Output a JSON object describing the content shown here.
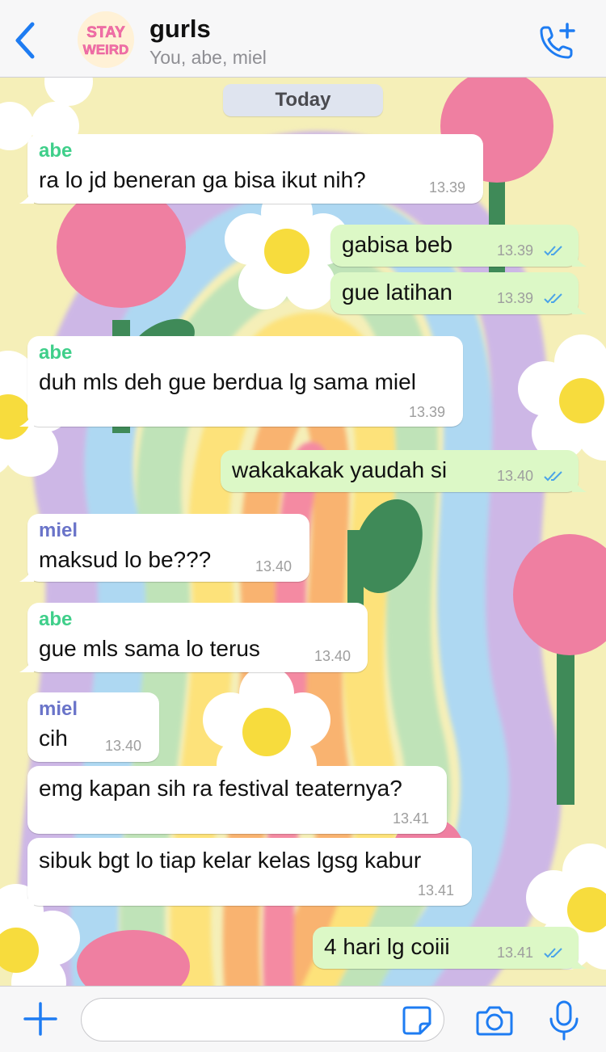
{
  "header": {
    "title": "gurls",
    "subtitle": "You, abe, miel",
    "avatar_text_line1": "STAY",
    "avatar_text_line2": "WEIRD"
  },
  "date_label": "Today",
  "messages": [
    {
      "dir": "in",
      "sender": "abe",
      "text": "ra lo jd beneran ga bisa ikut nih?",
      "time": "13.39"
    },
    {
      "dir": "out",
      "text": "gabisa beb",
      "time": "13.39",
      "status": "read"
    },
    {
      "dir": "out",
      "text": "gue latihan",
      "time": "13.39",
      "status": "read"
    },
    {
      "dir": "in",
      "sender": "abe",
      "text": "duh mls deh gue berdua lg sama miel",
      "time": "13.39"
    },
    {
      "dir": "out",
      "text": "wakakakak yaudah si",
      "time": "13.40",
      "status": "read"
    },
    {
      "dir": "in",
      "sender": "miel",
      "text": "maksud lo be???",
      "time": "13.40"
    },
    {
      "dir": "in",
      "sender": "abe",
      "text": "gue mls sama lo terus",
      "time": "13.40"
    },
    {
      "dir": "in",
      "sender": "miel",
      "text": "cih",
      "time": "13.40"
    },
    {
      "dir": "in",
      "text": "emg kapan sih ra festival teaternya?",
      "time": "13.41"
    },
    {
      "dir": "in",
      "text": "sibuk bgt lo tiap kelar kelas lgsg kabur",
      "time": "13.41"
    },
    {
      "dir": "out",
      "text": "4 hari lg coiii",
      "time": "13.41",
      "status": "read"
    }
  ],
  "composer": {
    "placeholder": ""
  },
  "colors": {
    "accent": "#1e7cf2",
    "outgoing_bubble": "#dcf8c6",
    "incoming_bubble": "#ffffff",
    "abe_name": "#3fcf8a",
    "miel_name": "#6a74c9",
    "read_ticks": "#4aa3e8"
  },
  "icons": [
    "back-chevron-icon",
    "add-call-icon",
    "plus-icon",
    "sticker-icon",
    "camera-icon",
    "microphone-icon",
    "read-receipt-icon"
  ]
}
